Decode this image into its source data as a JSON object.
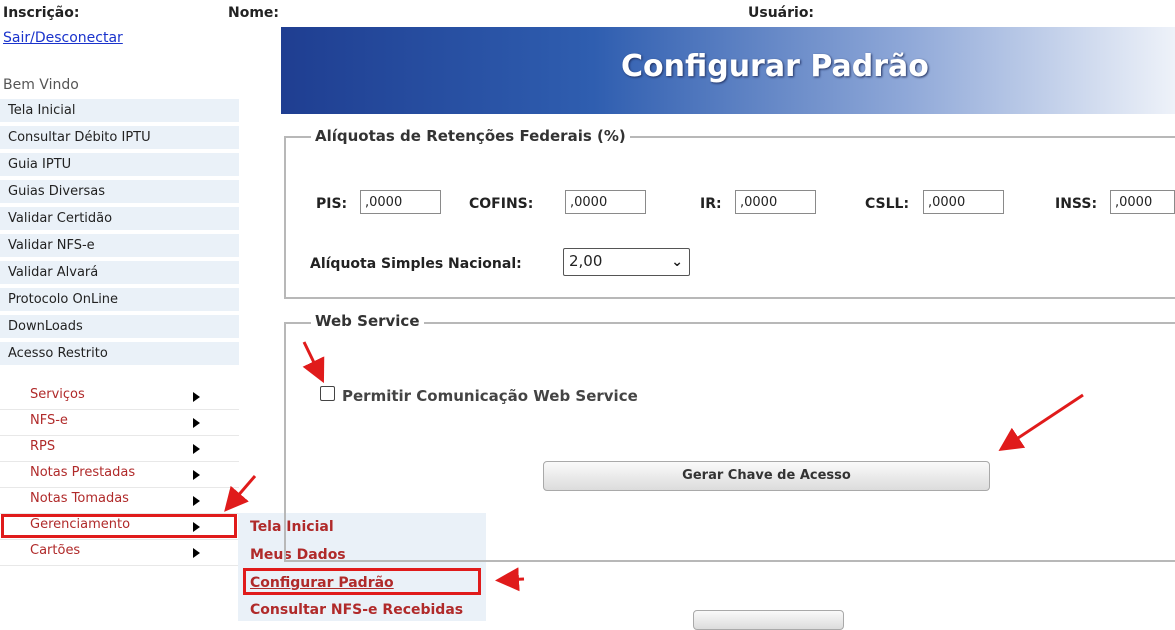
{
  "header": {
    "inscricao_label": "Inscrição:",
    "nome_label": "Nome:",
    "usuario_label": "Usuário:"
  },
  "logout_link": "Sair/Desconectar",
  "welcome_text": "Bem Vindo",
  "menu": {
    "items": [
      {
        "label": "Tela Inicial"
      },
      {
        "label": "Consultar Débito IPTU"
      },
      {
        "label": "Guia IPTU"
      },
      {
        "label": "Guias Diversas"
      },
      {
        "label": "Validar Certidão"
      },
      {
        "label": "Validar NFS-e"
      },
      {
        "label": "Validar Alvará"
      },
      {
        "label": "Protocolo OnLine"
      },
      {
        "label": "DownLoads"
      },
      {
        "label": "Acesso Restrito"
      }
    ],
    "subitems": [
      {
        "label": "Serviços"
      },
      {
        "label": "NFS-e"
      },
      {
        "label": "RPS"
      },
      {
        "label": "Notas Prestadas"
      },
      {
        "label": "Notas Tomadas"
      },
      {
        "label": "Gerenciamento"
      },
      {
        "label": "Cartões"
      }
    ]
  },
  "popup": {
    "items": [
      {
        "label": "Tela Inicial"
      },
      {
        "label": "Meus Dados"
      },
      {
        "label": "Configurar Padrão"
      },
      {
        "label": "Consultar NFS-e Recebidas"
      }
    ]
  },
  "banner": {
    "title": "Configurar Padrão"
  },
  "retencoes": {
    "legend": "Alíquotas de Retenções Federais (%)",
    "pis": {
      "label": "PIS:",
      "value": ",0000"
    },
    "cofins": {
      "label": "COFINS:",
      "value": ",0000"
    },
    "ir": {
      "label": "IR:",
      "value": ",0000"
    },
    "csll": {
      "label": "CSLL:",
      "value": ",0000"
    },
    "inss": {
      "label": "INSS:",
      "value": ",0000"
    },
    "simples_label": "Alíquota Simples Nacional:",
    "simples_value": "2,00"
  },
  "webservice": {
    "legend": "Web Service",
    "checkbox_label": "Permitir Comunicação Web Service",
    "button_label": "Gerar Chave de Acesso"
  },
  "colors": {
    "annotation_red": "#e01b1b",
    "menu_bg": "#eaf1f8",
    "submenu_text": "#b02a2a"
  }
}
